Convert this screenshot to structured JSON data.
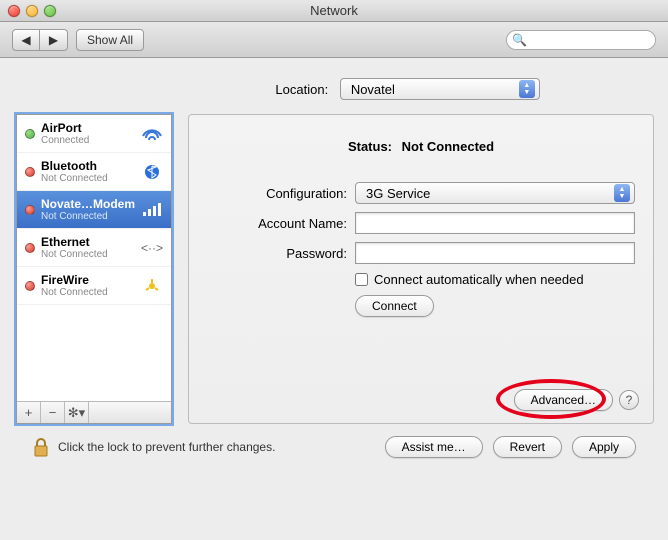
{
  "window": {
    "title": "Network"
  },
  "toolbar": {
    "showAll": "Show All",
    "searchPlaceholder": ""
  },
  "location": {
    "label": "Location:",
    "value": "Novatel"
  },
  "services": [
    {
      "name": "AirPort",
      "status": "Connected",
      "dot": "green",
      "icon": "wifi"
    },
    {
      "name": "Bluetooth",
      "status": "Not Connected",
      "dot": "red",
      "icon": "bluetooth"
    },
    {
      "name": "Novate…Modem",
      "status": "Not Connected",
      "dot": "red",
      "icon": "signal",
      "selected": true
    },
    {
      "name": "Ethernet",
      "status": "Not Connected",
      "dot": "red",
      "icon": "ethernet"
    },
    {
      "name": "FireWire",
      "status": "Not Connected",
      "dot": "red",
      "icon": "firewire"
    }
  ],
  "status": {
    "label": "Status:",
    "value": "Not Connected"
  },
  "config": {
    "configurationLabel": "Configuration:",
    "configurationValue": "3G Service",
    "accountLabel": "Account Name:",
    "accountValue": "",
    "passwordLabel": "Password:",
    "passwordValue": "",
    "autoConnect": "Connect automatically when needed",
    "connect": "Connect",
    "advanced": "Advanced…"
  },
  "footer": {
    "lockText": "Click the lock to prevent further changes.",
    "assist": "Assist me…",
    "revert": "Revert",
    "apply": "Apply"
  }
}
